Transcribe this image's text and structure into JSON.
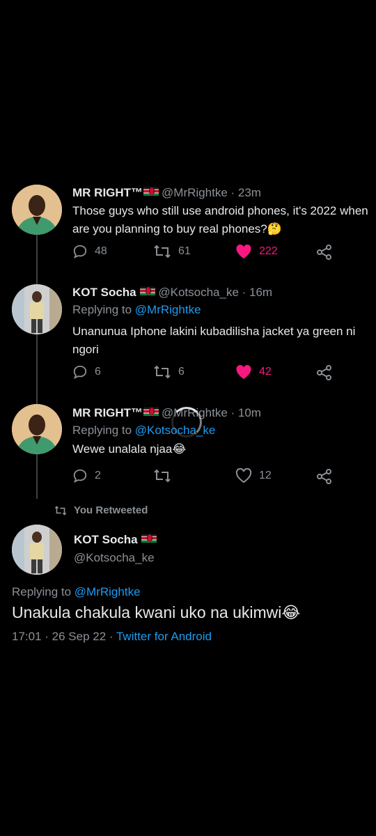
{
  "colors": {
    "background": "#000000",
    "link": "#1d9bf0",
    "like": "#f91880",
    "muted": "#8b9197"
  },
  "tweets": [
    {
      "name": "MR RIGHT™",
      "handle": "@MrRightke",
      "time": "23m",
      "text": "Those guys who still use android phones, it's 2022 when are you planning to buy real phones?",
      "emoji": "🤔",
      "replies": "48",
      "retweets": "61",
      "likes": "222",
      "liked": true
    },
    {
      "name": "KOT Socha",
      "handle": "@Kotsocha_ke",
      "time": "16m",
      "replying_label": "Replying to",
      "replying_to": "@MrRightke",
      "text": "Unanunua Iphone lakini kubadilisha jacket ya green ni ngori",
      "replies": "6",
      "retweets": "6",
      "likes": "42",
      "liked": true
    },
    {
      "name": "MR RIGHT™",
      "handle": "@MrRightke",
      "time": "10m",
      "replying_label": "Replying to",
      "replying_to": "@Kotsocha_ke",
      "text": "Wewe unalala njaa",
      "emoji": "😂",
      "replies": "2",
      "retweets": "",
      "likes": "12",
      "liked": false
    }
  ],
  "retweeted_label": "You Retweeted",
  "main_tweet": {
    "name": "KOT Socha",
    "handle": "@Kotsocha_ke",
    "replying_label": "Replying to",
    "replying_to": "@MrRightke",
    "text": "Unakula chakula kwani uko na ukimwi",
    "emoji": "😂",
    "timestamp": "17:01 · 26 Sep 22 · ",
    "source": "Twitter for Android"
  }
}
